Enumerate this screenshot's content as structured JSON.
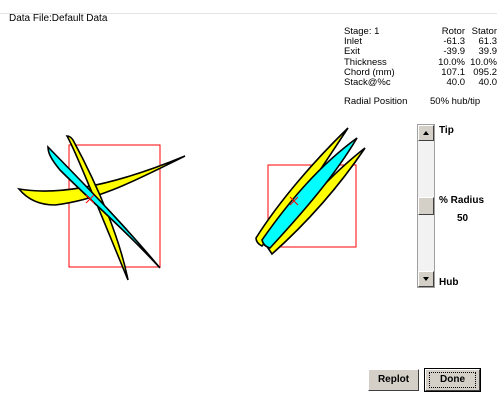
{
  "header": {
    "data_file": "Data File:Default Data"
  },
  "stage_table": {
    "rows": [
      {
        "label": "Stage:  1",
        "rotor": "Rotor",
        "stator": "Stator"
      },
      {
        "label": "Inlet",
        "rotor": "-61.3",
        "stator": "61.3"
      },
      {
        "label": "Exit",
        "rotor": "-39.9",
        "stator": "39.9"
      },
      {
        "label": "Thickness",
        "rotor": "10.0%",
        "stator": "10.0%"
      },
      {
        "label": "Chord (mm)",
        "rotor": "107.1",
        "stator": "095.2"
      },
      {
        "label": "Stack@%c",
        "rotor": "40.0",
        "stator": "40.0"
      }
    ],
    "radial_label": "Radial Position",
    "radial_value": "50% hub/tip"
  },
  "slider": {
    "tip_label": "Tip",
    "radius_label": "% Radius",
    "radius_value": "50",
    "hub_label": "Hub",
    "position_fraction": 0.5
  },
  "buttons": {
    "replot": "Replot",
    "done": "Done"
  },
  "colors": {
    "rotor_fill": "#ffff00",
    "stator_fill": "#00ffff",
    "stacking_box": "#ff0000",
    "outline": "#000000"
  }
}
